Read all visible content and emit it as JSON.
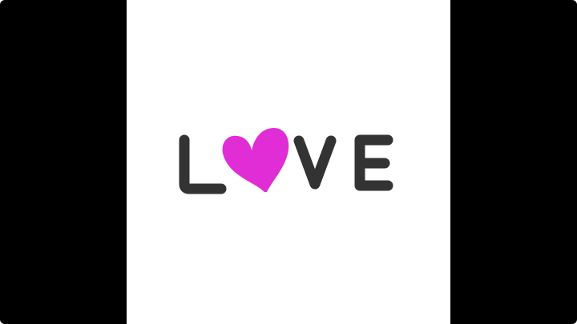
{
  "logo": {
    "word": "LOVE",
    "letter_color": "#333333",
    "heart_color": "#E02DD5",
    "heart_icon": "heart-icon"
  },
  "colors": {
    "letterbox": "#000000",
    "canvas": "#FFFFFF"
  }
}
